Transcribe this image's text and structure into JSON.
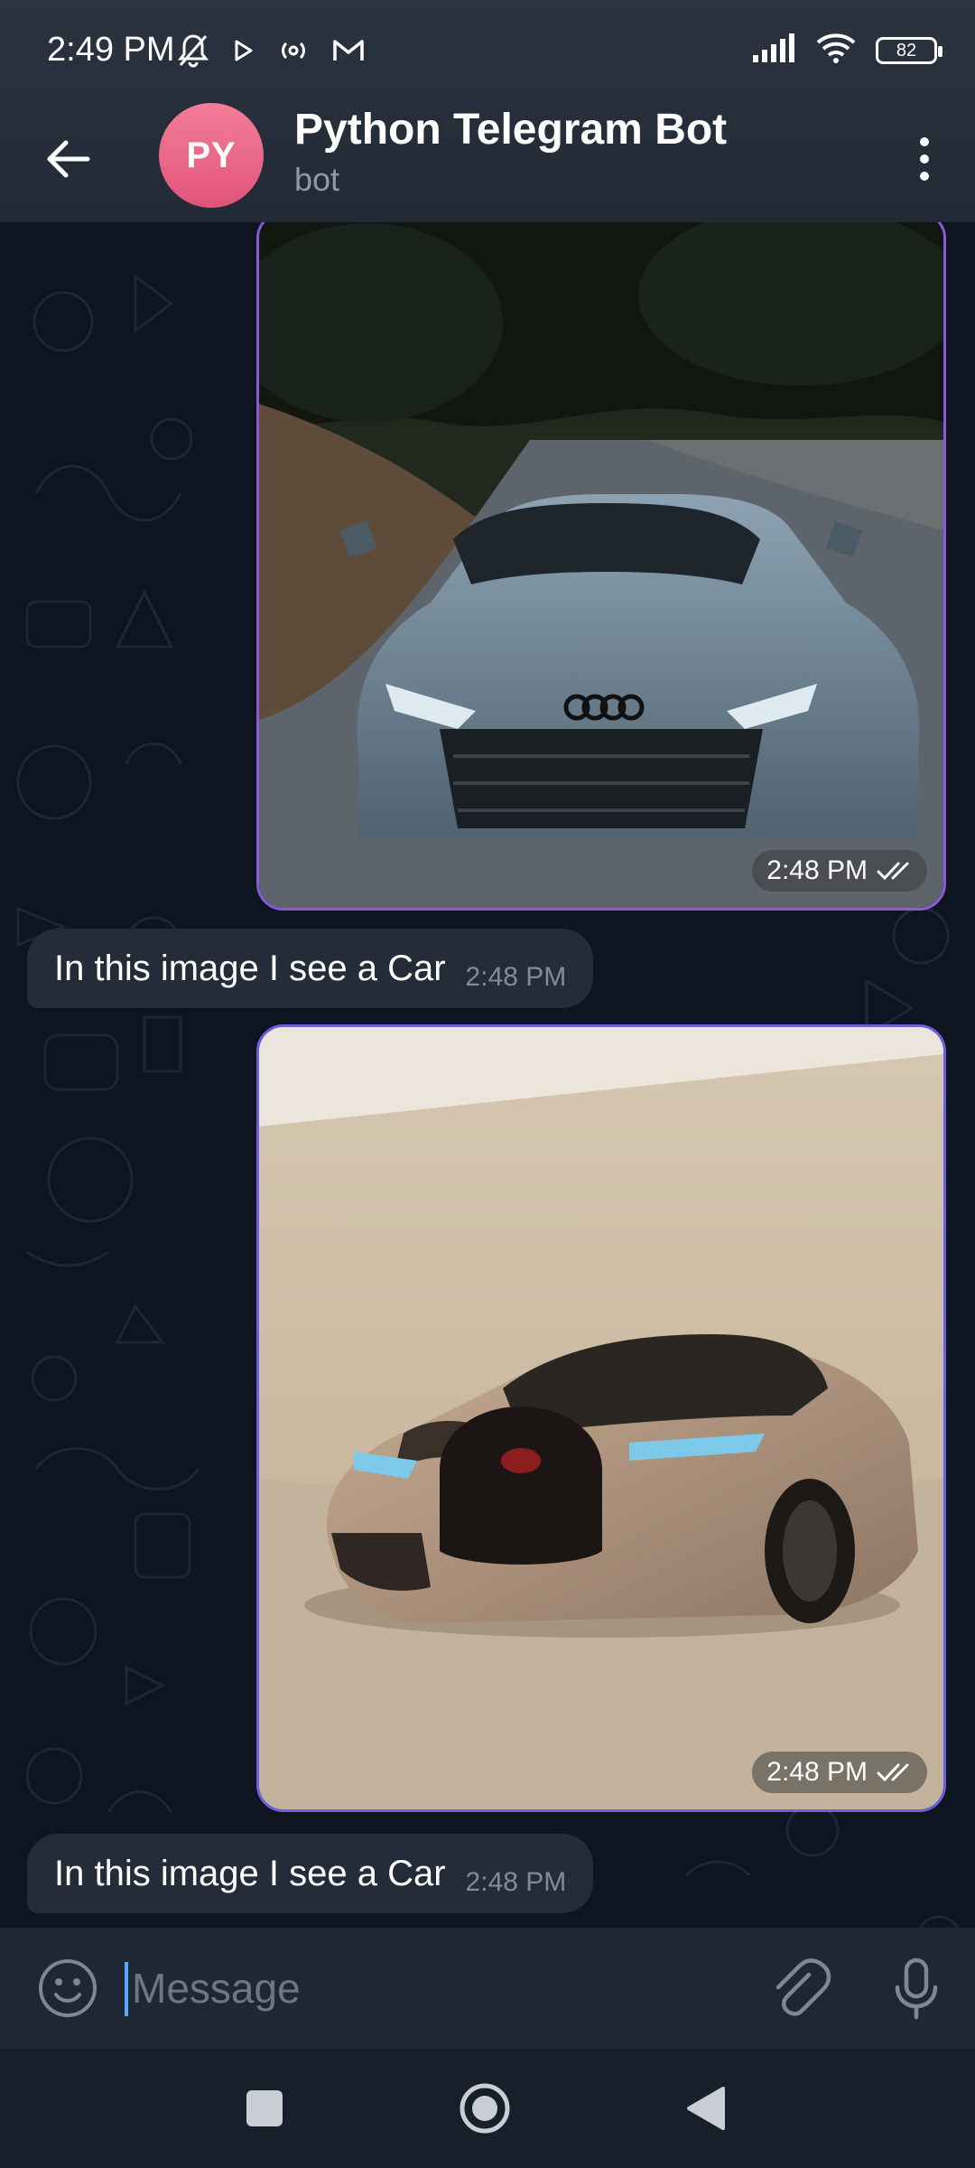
{
  "status_bar": {
    "time": "2:49 PM",
    "battery": "82",
    "icons": [
      "mute-bell-icon",
      "play-icon",
      "radio-icon",
      "gmail-icon",
      "signal-icon",
      "wifi-icon",
      "battery-icon"
    ]
  },
  "header": {
    "avatar_initials": "PY",
    "title": "Python Telegram Bot",
    "subtitle": "bot",
    "colors": {
      "avatar": "#e85c80",
      "header_bg": "#262e3a"
    }
  },
  "messages": [
    {
      "type": "photo",
      "from": "me",
      "subject": "Audi R8 on a forest road",
      "time": "2:48 PM",
      "status": "read"
    },
    {
      "type": "text",
      "from": "bot",
      "text": "In this image I see a Car",
      "time": "2:48 PM"
    },
    {
      "type": "photo",
      "from": "me",
      "subject": "Bugatti in a studio",
      "time": "2:48 PM",
      "status": "read"
    },
    {
      "type": "text",
      "from": "bot",
      "text": "In this image I see a Car",
      "time": "2:48 PM"
    }
  ],
  "composer": {
    "placeholder": "Message",
    "value": ""
  },
  "navbar": {
    "buttons": [
      "recents",
      "home",
      "back"
    ]
  }
}
